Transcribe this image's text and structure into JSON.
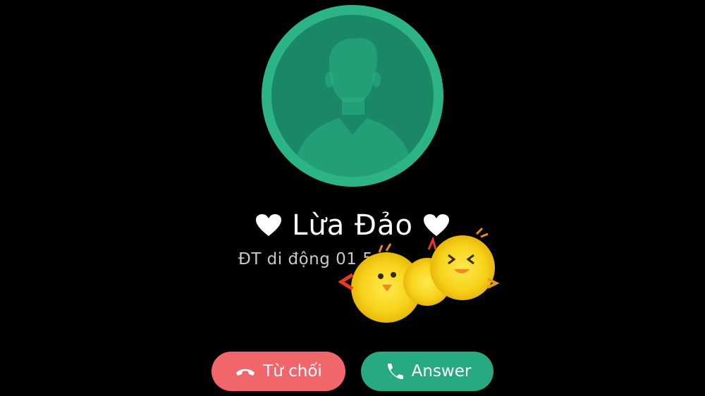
{
  "caller": {
    "name": "Lừa Đảo",
    "subtitle": "ĐT di động 01  5",
    "left_icon": "heart-icon",
    "right_icon": "heart-icon"
  },
  "avatar": {
    "icon": "person-silhouette-icon",
    "ring_color": "#2cb386",
    "fill_color": "#1a8866"
  },
  "sticker": {
    "icon": "chick-sticker-icon"
  },
  "actions": {
    "decline_label": "Từ chối",
    "decline_icon": "phone-hangup-icon",
    "decline_color": "#f0666a",
    "answer_label": "Answer",
    "answer_icon": "phone-icon",
    "answer_color": "#27a982"
  }
}
